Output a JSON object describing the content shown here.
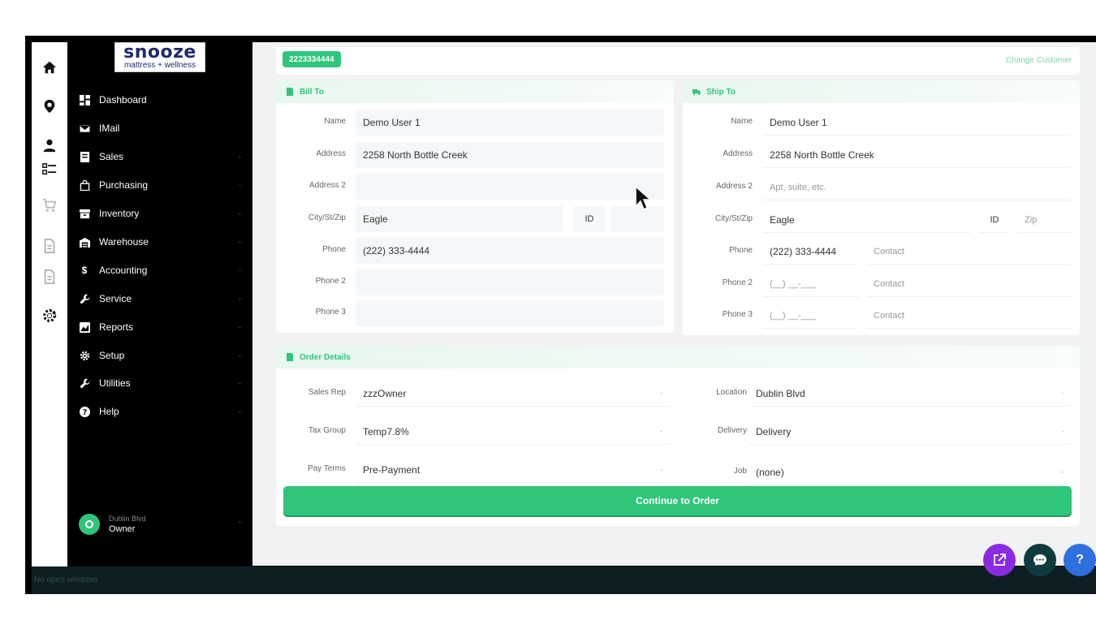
{
  "sidebar": {
    "logo_main": "snooze",
    "logo_sub": "mattress + wellness",
    "items": [
      {
        "label": "Dashboard",
        "icon": "dashboard-icon",
        "has_children": false
      },
      {
        "label": "IMail",
        "icon": "mail-icon",
        "has_children": false
      },
      {
        "label": "Sales",
        "icon": "sales-icon",
        "has_children": true
      },
      {
        "label": "Purchasing",
        "icon": "bag-icon",
        "has_children": true
      },
      {
        "label": "Inventory",
        "icon": "inventory-icon",
        "has_children": true
      },
      {
        "label": "Warehouse",
        "icon": "warehouse-icon",
        "has_children": true
      },
      {
        "label": "Accounting",
        "icon": "dollar-icon",
        "has_children": true
      },
      {
        "label": "Service",
        "icon": "wrench-icon",
        "has_children": true
      },
      {
        "label": "Reports",
        "icon": "reports-icon",
        "has_children": true
      },
      {
        "label": "Setup",
        "icon": "gear-icon",
        "has_children": true
      },
      {
        "label": "Utilities",
        "icon": "wrench-icon",
        "has_children": true
      },
      {
        "label": "Help",
        "icon": "help-icon",
        "has_children": true
      }
    ],
    "chevron": "-",
    "user": {
      "location": "Dublin Blvd",
      "role": "Owner"
    }
  },
  "topbar": {
    "phone_badge": "2223334444",
    "change_customer": "Change Customer"
  },
  "bill_to": {
    "title": "Bill To",
    "name_label": "Name",
    "name": "Demo User 1",
    "address_label": "Address",
    "address": "2258 North Bottle Creek",
    "address2_label": "Address 2",
    "address2": "",
    "city_label": "City/St/Zip",
    "city": "Eagle",
    "state": "ID",
    "zip": "",
    "phone_label": "Phone",
    "phone": "(222) 333-4444",
    "phone2_label": "Phone 2",
    "phone2": "",
    "phone3_label": "Phone 3",
    "phone3": ""
  },
  "ship_to": {
    "title": "Ship To",
    "name_label": "Name",
    "name": "Demo User 1",
    "address_label": "Address",
    "address": "2258 North Bottle Creek",
    "address2_label": "Address 2",
    "address2_placeholder": "Apt, suite, etc.",
    "city_label": "City/St/Zip",
    "city": "Eagle",
    "state": "ID",
    "zip_placeholder": "Zip",
    "phone_label": "Phone",
    "phone": "(222) 333-4444",
    "contact_placeholder": "Contact",
    "phone2_label": "Phone 2",
    "phone_placeholder": "(__) __-___",
    "phone3_label": "Phone 3"
  },
  "order_details": {
    "title": "Order Details",
    "sales_rep_label": "Sales Rep",
    "sales_rep": "zzzOwner",
    "tax_group_label": "Tax Group",
    "tax_group": "Temp7.8%",
    "pay_terms_label": "Pay Terms",
    "pay_terms": "Pre-Payment",
    "location_label": "Location",
    "location": "Dublin Blvd",
    "delivery_label": "Delivery",
    "delivery": "Delivery",
    "job_label": "Job",
    "job": "(none)",
    "select_chevron": "-",
    "continue_label": "Continue to Order"
  },
  "fabs": {
    "help_label": "?"
  },
  "bottombar": {
    "text": "No open windows"
  },
  "colors": {
    "accent": "#2fc57b",
    "sidebar_bg": "#000000",
    "fab_purple": "#8a2be2",
    "fab_dark": "#0d3b3e",
    "fab_blue": "#2f6fe0"
  }
}
